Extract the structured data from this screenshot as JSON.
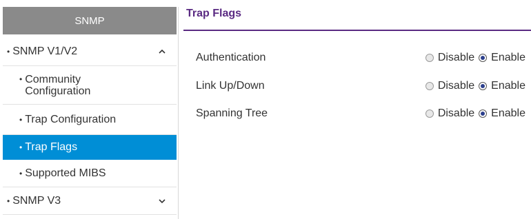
{
  "sidebar": {
    "header": "SNMP",
    "items": [
      {
        "label": "SNMP V1/V2",
        "icon": "chevron-up-icon"
      },
      {
        "label_line1": "Community",
        "label_line2": "Configuration"
      },
      {
        "label": "Trap Configuration"
      },
      {
        "label": "Trap Flags",
        "active": true
      },
      {
        "label": "Supported MIBS"
      },
      {
        "label": "SNMP V3",
        "icon": "chevron-down-icon"
      }
    ],
    "bullet": "•"
  },
  "main": {
    "title": "Trap Flags",
    "rows": [
      {
        "label": "Authentication",
        "option1": "Disable",
        "option2": "Enable",
        "selected": "Enable"
      },
      {
        "label": "Link Up/Down",
        "option1": "Disable",
        "option2": "Enable",
        "selected": "Enable"
      },
      {
        "label": "Spanning Tree",
        "option1": "Disable",
        "option2": "Enable",
        "selected": "Enable"
      }
    ]
  },
  "colors": {
    "accent": "#5a2a82",
    "active_bg": "#008ed6",
    "header_bg": "#8a8a8a"
  }
}
